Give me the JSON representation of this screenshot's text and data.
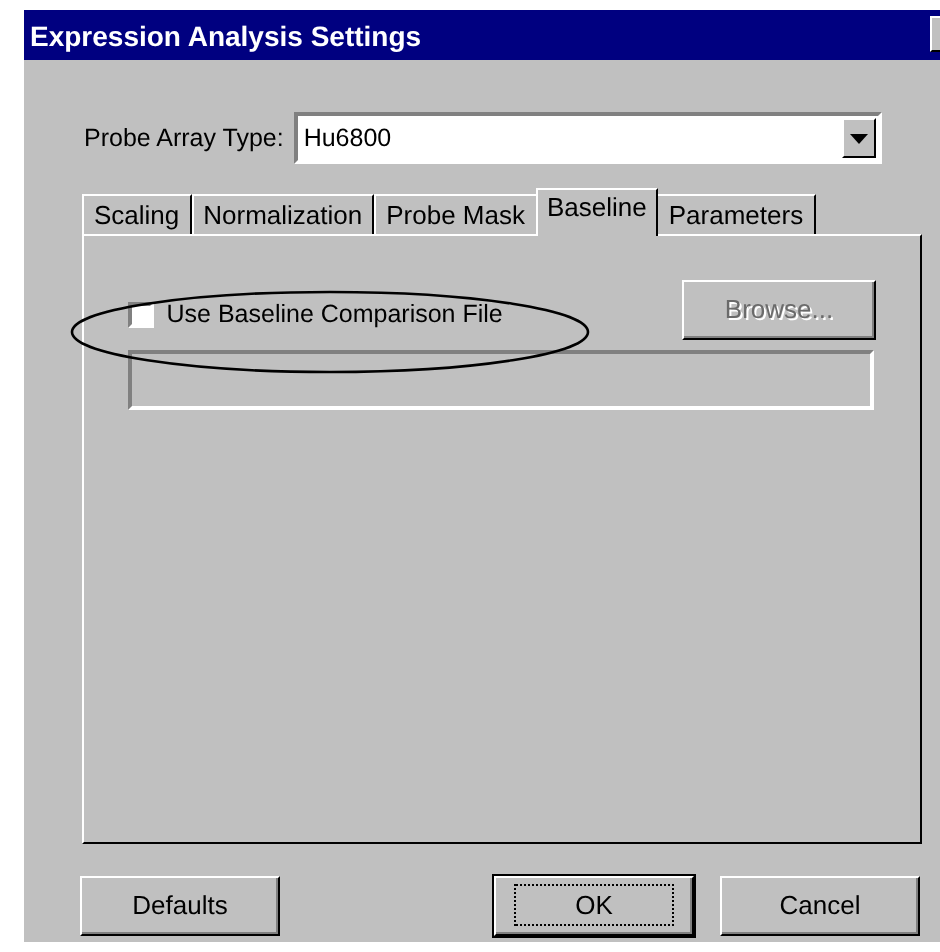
{
  "window": {
    "title": "Expression Analysis Settings"
  },
  "probe_array_type": {
    "label": "Probe Array Type:",
    "value": "Hu6800"
  },
  "tabs": [
    {
      "label": "Scaling",
      "selected": false
    },
    {
      "label": "Normalization",
      "selected": false
    },
    {
      "label": "Probe Mask",
      "selected": false
    },
    {
      "label": "Baseline",
      "selected": true
    },
    {
      "label": "Parameters",
      "selected": false
    }
  ],
  "baseline": {
    "checkbox": {
      "label": "Use Baseline Comparison File",
      "checked": false
    },
    "browse_button": {
      "label": "Browse...",
      "disabled": true
    },
    "file_field": {
      "disabled": true
    }
  },
  "buttons": [
    {
      "label": "Defaults",
      "default": false
    },
    {
      "label": "OK",
      "default": true
    },
    {
      "label": "Cancel",
      "default": false
    }
  ]
}
